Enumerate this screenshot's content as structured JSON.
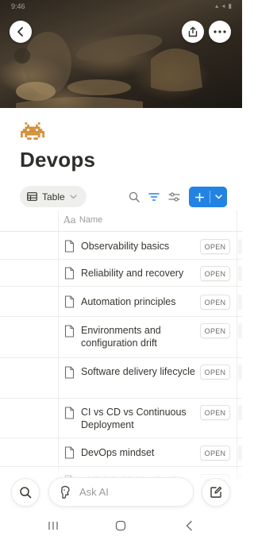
{
  "status_bar": {
    "time": "9:46",
    "indicators": "▴ ◂ ▮"
  },
  "header": {
    "back_icon": "chevron-left-icon",
    "share_icon": "share-icon",
    "more_icon": "more-horizontal-icon"
  },
  "page": {
    "icon": "space-invader-icon",
    "icon_color": "#d29039",
    "title": "Devops"
  },
  "toolbar": {
    "view_label": "Table",
    "view_icon": "table-icon",
    "new_button_color": "#2383e2"
  },
  "table": {
    "name_column": "Name",
    "open_label": "OPEN",
    "rows": [
      {
        "title": "Observability basics"
      },
      {
        "title": "Reliability and recovery"
      },
      {
        "title": "Automation principles"
      },
      {
        "title": "Environments and configuration drift"
      },
      {
        "title": "Software delivery lifecycle"
      },
      {
        "title": "CI vs CD vs Continuous Deployment"
      },
      {
        "title": "DevOps mindset"
      },
      {
        "title": "Shift-left thinking basics"
      }
    ]
  },
  "bottom_bar": {
    "search_icon": "search-icon",
    "ask_ai_placeholder": "Ask AI",
    "compose_icon": "compose-icon"
  },
  "android_nav": {
    "recents_icon": "recents-icon",
    "home_icon": "home-icon",
    "back_icon": "back-icon"
  }
}
